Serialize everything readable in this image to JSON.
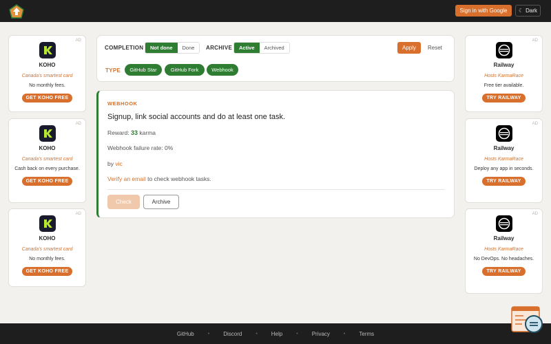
{
  "header": {
    "signin_label": "Sign in with Google",
    "dark_label": "Dark",
    "moon_icon": "moon-icon"
  },
  "ads_left": [
    {
      "tag": "AD",
      "name": "KOHO",
      "tagline": "Canada's smartest card",
      "desc": "No monthly fees.",
      "cta": "GET KOHO FREE"
    },
    {
      "tag": "AD",
      "name": "KOHO",
      "tagline": "Canada's smartest card",
      "desc": "Cash back on every purchase.",
      "cta": "GET KOHO FREE"
    },
    {
      "tag": "AD",
      "name": "KOHO",
      "tagline": "Canada's smartest card",
      "desc": "No monthly fees.",
      "cta": "GET KOHO FREE"
    }
  ],
  "ads_right": [
    {
      "tag": "AD",
      "name": "Railway",
      "tagline": "Hosts KarmaRace",
      "desc": "Free tier available.",
      "cta": "TRY RAILWAY"
    },
    {
      "tag": "AD",
      "name": "Railway",
      "tagline": "Hosts KarmaRace",
      "desc": "Deploy any app in seconds.",
      "cta": "TRY RAILWAY"
    },
    {
      "tag": "AD",
      "name": "Railway",
      "tagline": "Hosts KarmaRace",
      "desc": "No DevOps. No headaches.",
      "cta": "TRY RAILWAY"
    }
  ],
  "filters": {
    "completion_label": "COMPLETION",
    "completion_options": [
      "Not done",
      "Done"
    ],
    "archive_label": "ARCHIVE",
    "archive_options": [
      "Active",
      "Archived"
    ],
    "apply_label": "Apply",
    "reset_label": "Reset",
    "type_label": "TYPE",
    "types": [
      "GitHub Star",
      "GitHub Fork",
      "Webhook"
    ]
  },
  "task": {
    "kind": "WEBHOOK",
    "title": "Signup, link social accounts and do at least one task.",
    "reward_prefix": "Reward:",
    "reward_value": "33",
    "reward_unit": "karma",
    "failure_rate": "Webhook failure rate: 0%",
    "by_prefix": "by",
    "author": "vic",
    "verify_link": "Verify an email",
    "verify_suffix": "to check webhook tasks.",
    "check_label": "Check",
    "archive_label": "Archive"
  },
  "footer": {
    "links": [
      "GitHub",
      "Discord",
      "Help",
      "Privacy",
      "Terms"
    ],
    "separator": "•"
  },
  "colors": {
    "accent": "#d96f2c",
    "active_green": "#2e7d32",
    "bar_dark": "#1e1e1e"
  }
}
